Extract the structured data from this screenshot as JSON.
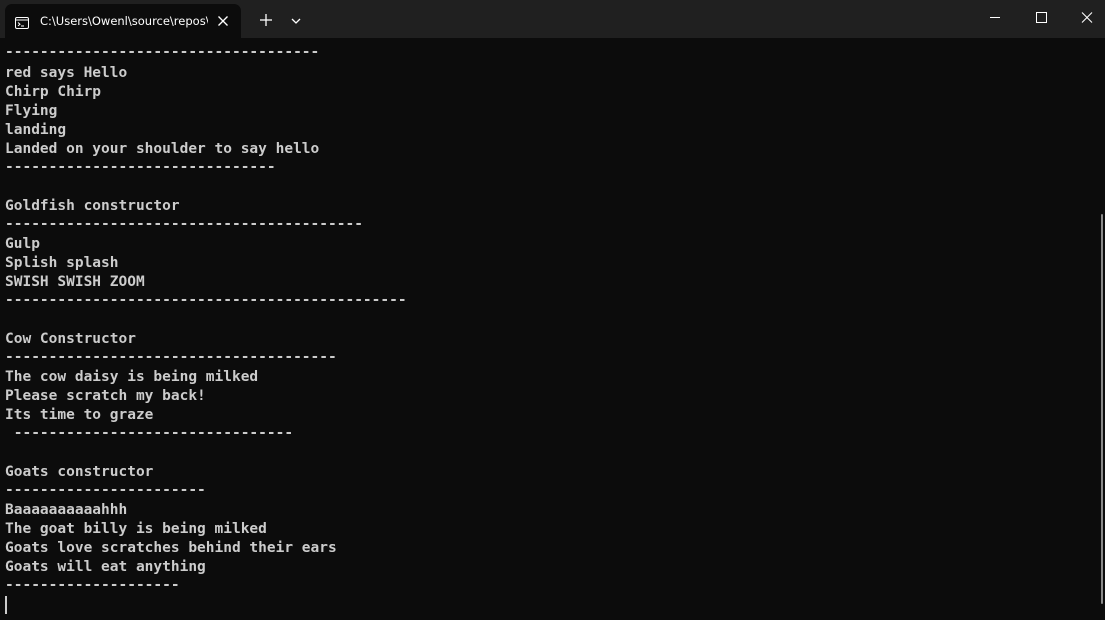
{
  "window": {
    "tab_title": "C:\\Users\\Owenl\\source\\repos\\",
    "new_tab_label": "+",
    "icons": {
      "tab": "terminal-icon",
      "close_tab": "close-icon",
      "new_tab": "plus-icon",
      "dropdown": "chevron-down-icon",
      "minimize": "minimize-icon",
      "maximize": "maximize-icon",
      "close_window": "close-icon"
    },
    "colors": {
      "background": "#0c0c0c",
      "titlebar": "#202020",
      "text": "#cccccc"
    }
  },
  "terminal": {
    "lines": [
      "------------------------------------",
      "red says Hello",
      "Chirp Chirp",
      "Flying",
      "landing",
      "Landed on your shoulder to say hello",
      "-------------------------------",
      "",
      "Goldfish constructor",
      "-----------------------------------------",
      "Gulp",
      "Splish splash",
      "SWISH SWISH ZOOM",
      "----------------------------------------------",
      "",
      "Cow Constructor",
      "--------------------------------------",
      "The cow daisy is being milked",
      "Please scratch my back!",
      "Its time to graze",
      " --------------------------------",
      "",
      "Goats constructor",
      "-----------------------",
      "Baaaaaaaaaahhh",
      "The goat billy is being milked",
      "Goats love scratches behind their ears",
      "Goats will eat anything",
      "--------------------"
    ]
  }
}
